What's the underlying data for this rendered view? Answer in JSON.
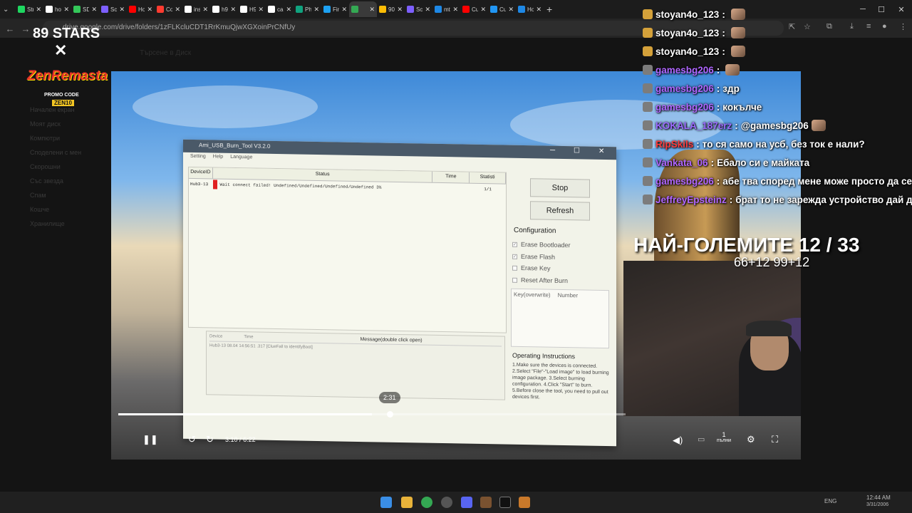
{
  "browser": {
    "tabs": [
      {
        "label": "Stre",
        "color": "#1ed760",
        "active": false
      },
      {
        "label": "how",
        "color": "#ffffff",
        "active": false
      },
      {
        "label": "SDK",
        "color": "#34c759",
        "active": false
      },
      {
        "label": "Scre",
        "color": "#7d5fff",
        "active": false
      },
      {
        "label": "How",
        "color": "#ff0000",
        "active": false
      },
      {
        "label": "Con",
        "color": "#ff3b30",
        "active": false
      },
      {
        "label": "insti",
        "color": "#ffffff",
        "active": false
      },
      {
        "label": "h96",
        "color": "#ffffff",
        "active": false
      },
      {
        "label": "H96",
        "color": "#ffffff",
        "active": false
      },
      {
        "label": "cant",
        "color": "#ffffff",
        "active": false
      },
      {
        "label": "Pho",
        "color": "#10a37f",
        "active": false
      },
      {
        "label": "Firm",
        "color": "#1da1f2",
        "active": false
      },
      {
        "label": "",
        "color": "#34a853",
        "active": true
      },
      {
        "label": "905",
        "color": "#fbbc05",
        "active": false
      },
      {
        "label": "Scre",
        "color": "#7d5fff",
        "active": false
      },
      {
        "label": "mt",
        "color": "#1e88e5",
        "active": false
      },
      {
        "label": "Cus",
        "color": "#ff0000",
        "active": false
      },
      {
        "label": "Cus",
        "color": "#2196f3",
        "active": false
      },
      {
        "label": "How",
        "color": "#1e88e5",
        "active": false
      }
    ],
    "url": "drive.google.com/drive/folders/1zFLKcluCDT1RrKmuQjwXGXoinPrCNfUy"
  },
  "drive_bg": {
    "search_placeholder": "Търсене в Диск",
    "side_items": [
      "Начален екран",
      "Моят диск",
      "Компютри",
      "Споделени с мен",
      "Скорошни",
      "Със звезда",
      "Спам",
      "Кошче",
      "Хранилище"
    ]
  },
  "logo": {
    "line1": "89 STARS",
    "cross": "✕",
    "line2": "ZenRemasta",
    "line3": "PROMO CODE",
    "line4": "ZEN10"
  },
  "app_window": {
    "title": "Ami_USB_Burn_Tool V3.2.0",
    "menu": [
      "Setting",
      "Help",
      "Language"
    ],
    "columns": [
      "DeviceID",
      "Status",
      "Time",
      "Statisti"
    ],
    "row": {
      "device": "Hub3-13",
      "status": "Wait connect failed! Undefined/Undefined/Undefined/Undefined 3%",
      "time": "",
      "stat": "1/1"
    },
    "log_columns": [
      "Device",
      "Time",
      "Message(double click open)"
    ],
    "log_row": "Hub3-13  08.04 14:56:51 .317  [ClueFall to identifyBoot]",
    "stop_label": "Stop",
    "refresh_label": "Refresh",
    "config_title": "Configuration",
    "checks": [
      {
        "label": "Erase Bootloader",
        "checked": true
      },
      {
        "label": "Erase Flash",
        "checked": true
      },
      {
        "label": "Erase Key",
        "checked": false
      },
      {
        "label": "Reset After Burn",
        "checked": false
      }
    ],
    "key_cols": [
      "Key(overwrite)",
      "Number"
    ],
    "ops_title": "Operating Instructions",
    "ops_text": "1.Make sure the devices is connected. 2.Select \"File\"-\"Load image\" to load burning image package. 3.Select burning configuration. 4.Click \"Start\" to burn. 5.Before close the tool, you need to pull out devices first."
  },
  "player": {
    "hover_time": "2:31",
    "current_time": "3:10",
    "separator": "/",
    "duration": "6:22",
    "progress_fraction": 0.5,
    "speed_label": "1",
    "speed_sub": "пълни"
  },
  "chat": [
    {
      "user": "stoyan4o_123",
      "sep": ":",
      "text": "",
      "user_color": "#ffffff",
      "emote": true
    },
    {
      "user": "stoyan4o_123",
      "sep": ":",
      "text": "",
      "user_color": "#ffffff",
      "emote": true
    },
    {
      "user": "stoyan4o_123",
      "sep": ":",
      "text": "",
      "user_color": "#ffffff",
      "emote": true
    },
    {
      "user": "gamesbg206",
      "sep": ":",
      "text": "",
      "user_color": "#b066ff",
      "emote": true
    },
    {
      "user": "gamesbg206",
      "sep": ":",
      "text": "здр",
      "user_color": "#b066ff",
      "emote": false
    },
    {
      "user": "gamesbg206",
      "sep": ":",
      "text": "кокълче",
      "user_color": "#b066ff",
      "emote": false
    },
    {
      "user": "KOKALA_187erz",
      "sep": ":",
      "text": "@gamesbg206",
      "user_color": "#9b6bff",
      "emote": true
    },
    {
      "user": "RipSkils",
      "sep": ":",
      "text": "то ся само на усб, без ток е нали?",
      "user_color": "#ff3b3b",
      "emote": false
    },
    {
      "user": "Vankata_06",
      "sep": ":",
      "text": "Ебало си е майката",
      "user_color": "#b066ff",
      "emote": false
    },
    {
      "user": "gamesbg206",
      "sep": ":",
      "text": "абе тва според мене може просто да се",
      "user_color": "#b066ff",
      "emote": false
    },
    {
      "user": "JeffreyEpsteinz",
      "sep": ":",
      "text": "брат то не зарежда устройство дай д",
      "user_color": "#b066ff",
      "emote": false
    }
  ],
  "overlay": {
    "title": "НАЙ-ГОЛЕМИТЕ 12 / 33",
    "score": "66+12 99+12"
  },
  "taskbar": {
    "lang": "ENG",
    "time": "12:44 AM",
    "date": "3/31/2006"
  }
}
